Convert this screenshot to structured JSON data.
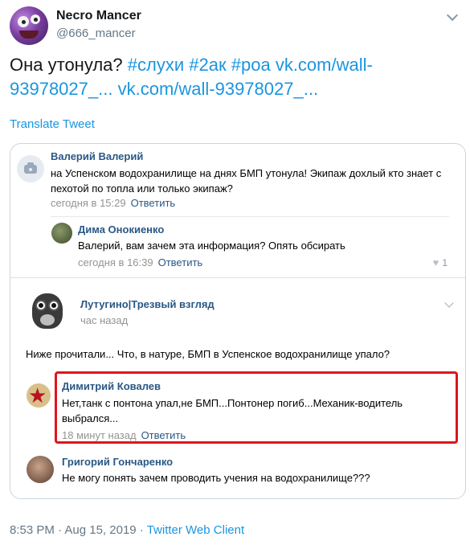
{
  "tweet": {
    "display_name": "Necro Mancer",
    "handle": "@666_mancer",
    "text_plain": "Она утонула? ",
    "hashtags": [
      "#слухи",
      "#2ак",
      "#роа"
    ],
    "link1": "vk.com/wall-93978027_...",
    "link2": "vk.com/wall-93978027_...",
    "translate_label": "Translate Tweet",
    "time": "8:53 PM",
    "separator": " · ",
    "date": "Aug 15, 2019",
    "client": "Twitter Web Client"
  },
  "card": {
    "comments": [
      {
        "author": "Валерий Валерий",
        "text": "на Успенском водохранилище на днях БМП утонула! Экипаж дохлый кто знает с пехотой по топла или только экипаж?",
        "time": "сегодня в 15:29",
        "reply_label": "Ответить"
      },
      {
        "author": "Дима Онокиенко",
        "text": "Валерий, вам зачем эта информация? Опять обсирать",
        "time": "сегодня в 16:39",
        "reply_label": "Ответить",
        "likes": "1"
      }
    ],
    "post": {
      "author": "Лутугино|Трезвый взгляд",
      "time": "час назад",
      "text": "Ниже прочитали... Что, в натуре, БМП в Успенское водохранилище упало?"
    },
    "replies": [
      {
        "author": "Димитрий Ковалев",
        "text": "Нет,танк с понтона упал,не БМП...Понтонер погиб...Механик-водитель выбрался...",
        "time": "18 минут назад",
        "reply_label": "Ответить"
      },
      {
        "author": "Григорий Гончаренко",
        "text": "Не могу понять зачем проводить учения на водохранилище???"
      }
    ]
  },
  "colors": {
    "twitter_link": "#1b95e0",
    "vk_name": "#2a5885",
    "highlight": "#e0141e"
  }
}
